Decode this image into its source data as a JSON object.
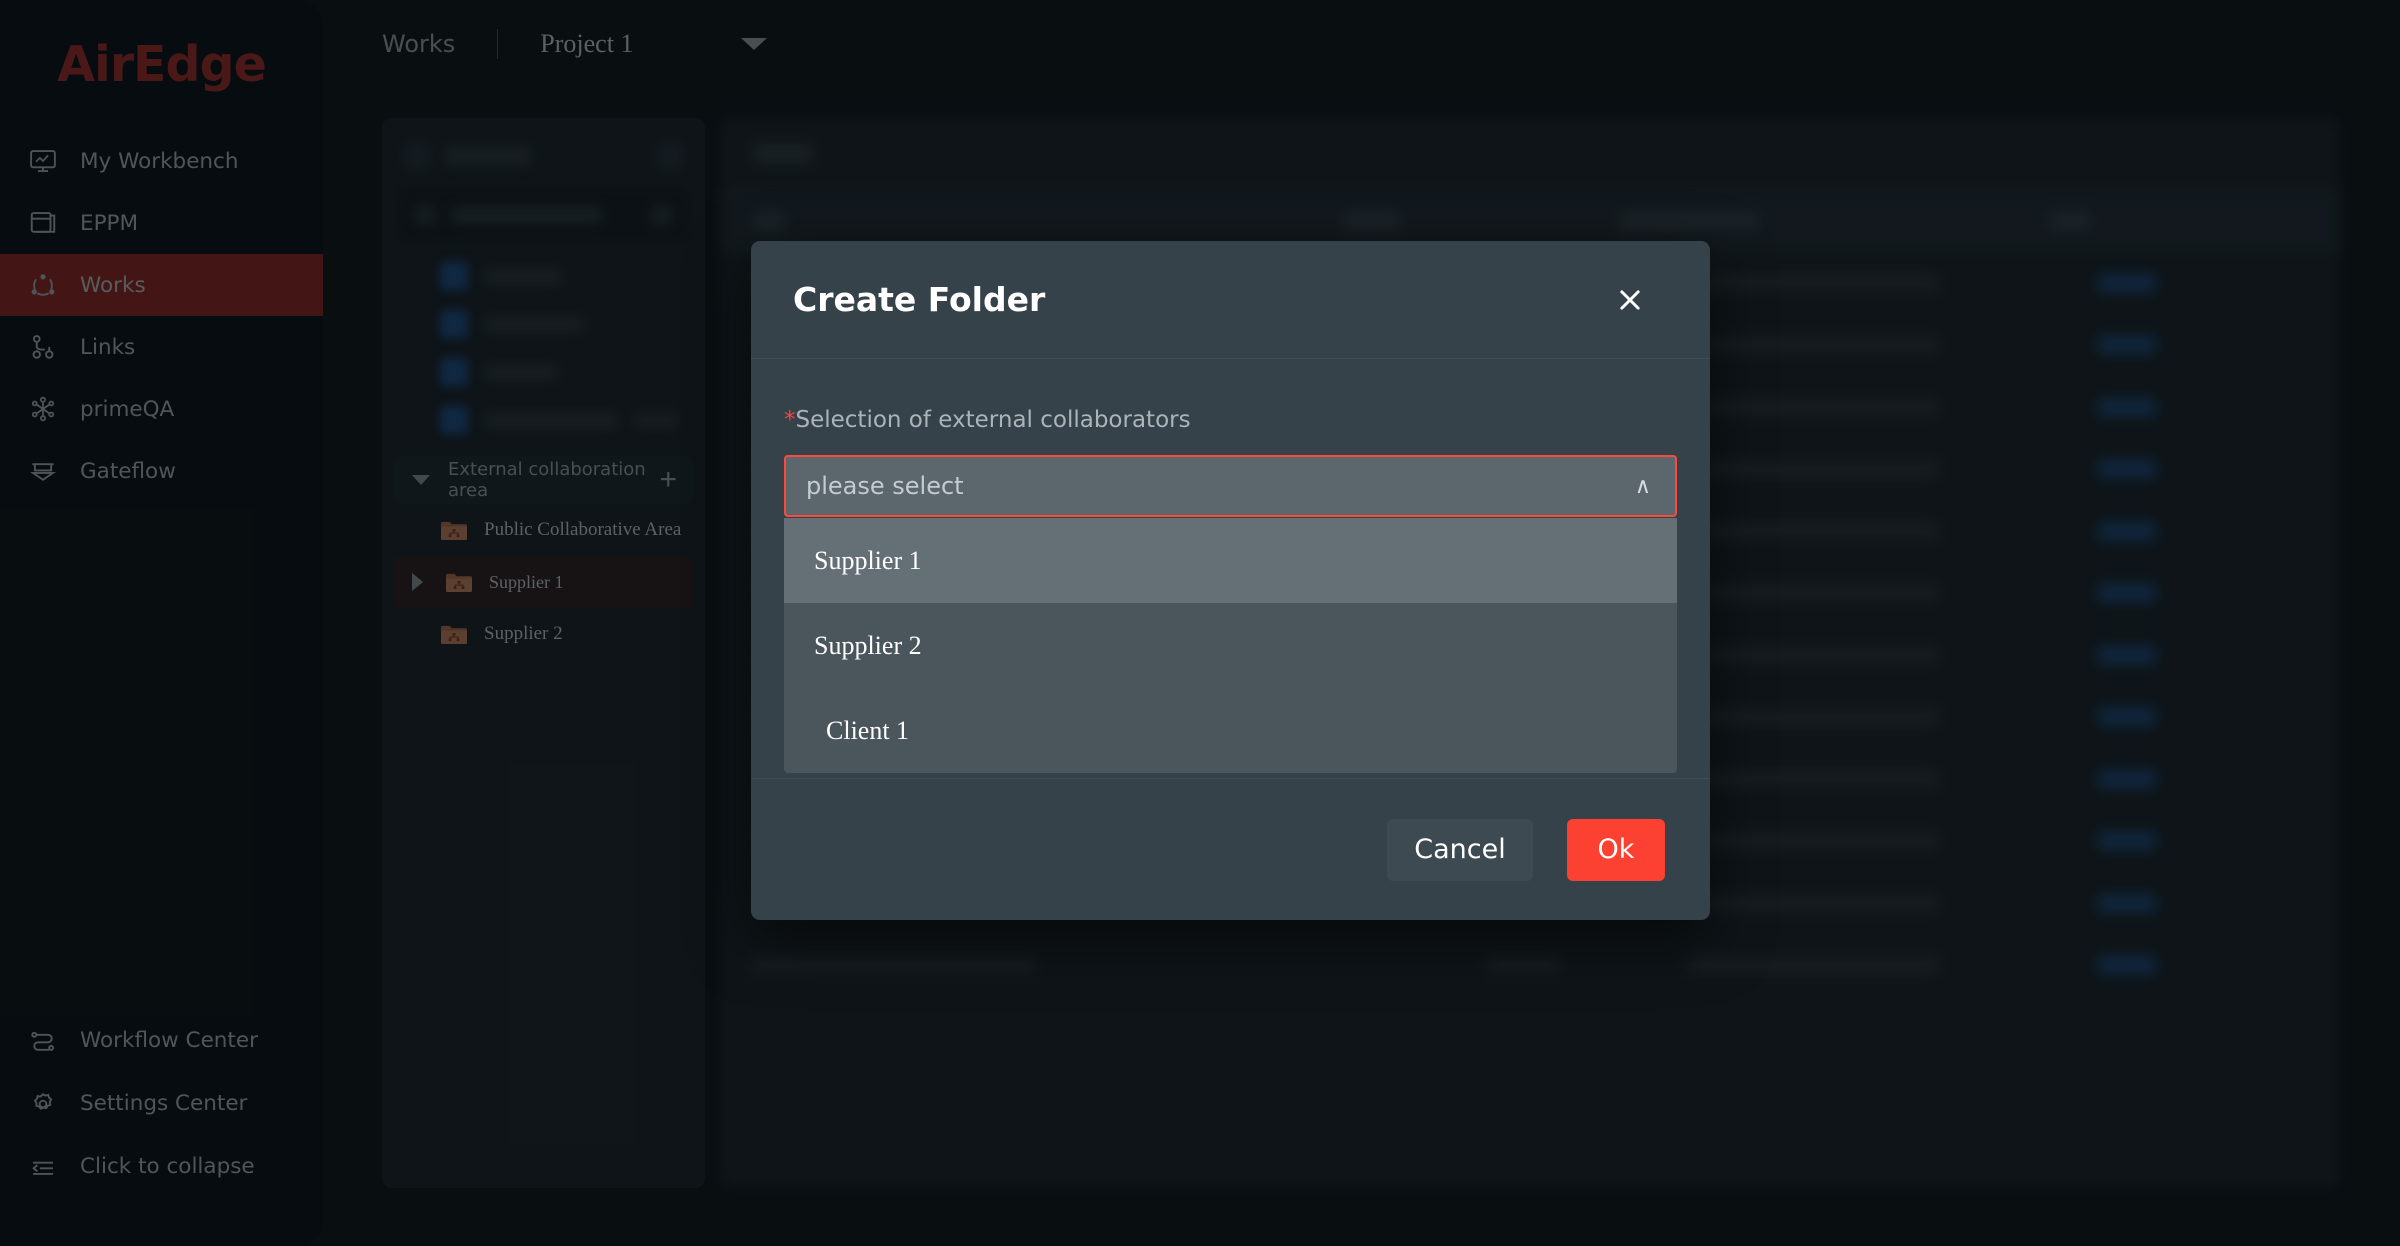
{
  "brand": {
    "name": "AirEdge",
    "color": "#9c2c24"
  },
  "sidebar": {
    "items": [
      {
        "label": "My Workbench",
        "icon": "monitor-chart-icon",
        "active": false
      },
      {
        "label": "EPPM",
        "icon": "window-stack-icon",
        "active": false
      },
      {
        "label": "Works",
        "icon": "share-nodes-icon",
        "active": true
      },
      {
        "label": "Links",
        "icon": "link-branch-icon",
        "active": false
      },
      {
        "label": "primeQA",
        "icon": "asterisk-nodes-icon",
        "active": false
      },
      {
        "label": "Gateflow",
        "icon": "gate-funnel-icon",
        "active": false
      }
    ],
    "bottom_items": [
      {
        "label": "Workflow Center",
        "icon": "workflow-icon"
      },
      {
        "label": "Settings Center",
        "icon": "gear-icon"
      },
      {
        "label": "Click to collapse",
        "icon": "collapse-icon"
      }
    ]
  },
  "topbar": {
    "module": "Works",
    "project": "Project 1"
  },
  "tree": {
    "section": {
      "title": "External collaboration area",
      "expanded": true,
      "add_label": "+"
    },
    "items": [
      {
        "label": "Public Collaborative Area",
        "selected": false,
        "expandable": false
      },
      {
        "label": "Supplier 1",
        "selected": true,
        "expandable": true
      },
      {
        "label": "Supplier 2",
        "selected": false,
        "expandable": false
      }
    ]
  },
  "modal": {
    "title": "Create Folder",
    "close_label": "✕",
    "field": {
      "required_mark": "*",
      "label": "Selection of external collaborators",
      "placeholder": "please select",
      "value": "",
      "expanded": true,
      "chevron": "∧",
      "options": [
        {
          "label": "Supplier 1",
          "hovered": true
        },
        {
          "label": "Supplier 2",
          "hovered": false
        },
        {
          "label": "Client 1",
          "hovered": false
        }
      ]
    },
    "cancel_label": "Cancel",
    "ok_label": "Ok",
    "accent_color": "#fc4031"
  }
}
